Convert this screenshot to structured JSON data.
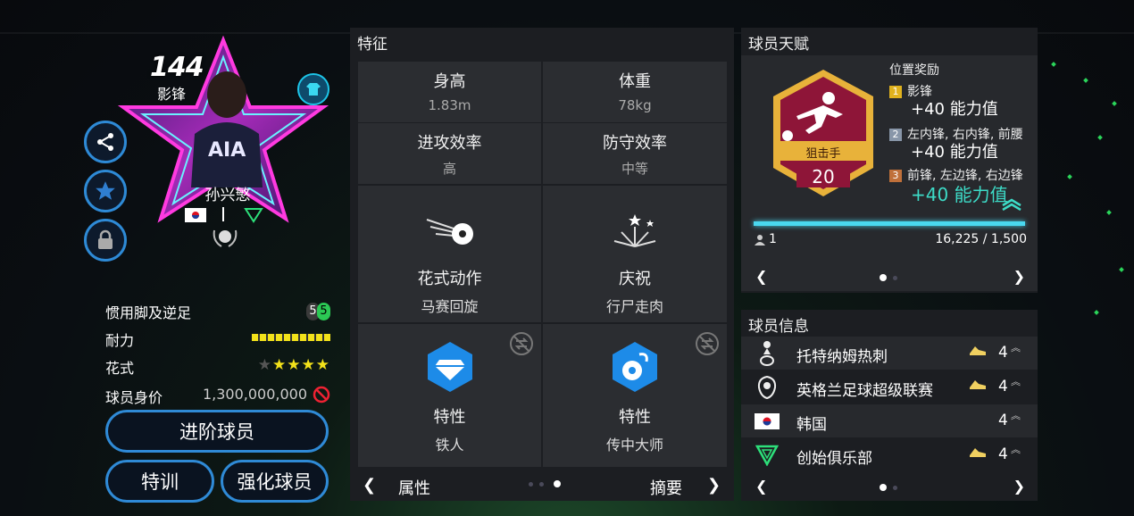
{
  "player": {
    "rating": "144",
    "position": "影锋",
    "name": "孙兴慜",
    "nationality": "韩国",
    "stats": [
      {
        "label": "惯用脚及逆足",
        "value_main": "5",
        "value_weak": "5"
      },
      {
        "label": "耐力"
      },
      {
        "label": "花式"
      },
      {
        "label": "球员身价",
        "value": "1,300,000,000"
      }
    ],
    "stamina_level": 1.0,
    "skill_stars": 4,
    "skill_stars_max": 5
  },
  "buttons": {
    "advance": "进阶球员",
    "train": "特训",
    "strengthen": "强化球员"
  },
  "features": {
    "title": "特征",
    "height_label": "身高",
    "height_value": "1.83m",
    "weight_label": "体重",
    "weight_value": "78kg",
    "attack_label": "进攻效率",
    "attack_value": "高",
    "defense_label": "防守效率",
    "defense_value": "中等",
    "skill_move_label": "花式动作",
    "skill_move_value": "马赛回旋",
    "celebration_label": "庆祝",
    "celebration_value": "行尸走肉",
    "trait1_label": "特性",
    "trait1_value": "铁人",
    "trait2_label": "特性",
    "trait2_value": "传中大师",
    "footer_left": "属性",
    "footer_right": "摘要"
  },
  "talent": {
    "title": "球员天赋",
    "badge_name": "狙击手",
    "badge_level": "20",
    "bonus_title": "位置奖励",
    "bonuses": [
      {
        "rank": "1",
        "positions": "影锋",
        "value": "+40 能力值"
      },
      {
        "rank": "2",
        "positions": "左内锋, 右内锋, 前腰",
        "value": "+40 能力值"
      },
      {
        "rank": "3",
        "positions": "前锋, 左边锋, 右边锋",
        "value": "+40 能力值"
      }
    ],
    "progress_count": "1",
    "progress_text": "16,225 / 1,500",
    "progress": 1.0
  },
  "info": {
    "title": "球员信息",
    "rows": [
      {
        "name": "托特纳姆热刺",
        "level": "4"
      },
      {
        "name": "英格兰足球超级联赛",
        "level": "4"
      },
      {
        "name": "韩国",
        "level": "4"
      },
      {
        "name": "创始俱乐部",
        "level": "4"
      }
    ]
  },
  "colors": {
    "accent_blue": "#2f8ad6",
    "bonus_cyan": "#3ddbc7",
    "stamina_yellow": "#f3e21a",
    "badge_red": "#8e1538",
    "badge_gold": "#e8b23a"
  },
  "icons": [
    "share-icon",
    "star-icon",
    "lock-icon",
    "club-shirt-icon",
    "ball-icon",
    "fireworks-icon",
    "diamond-icon",
    "trait-ball-icon",
    "swap-icon",
    "boot-icon",
    "no-sell-icon"
  ]
}
